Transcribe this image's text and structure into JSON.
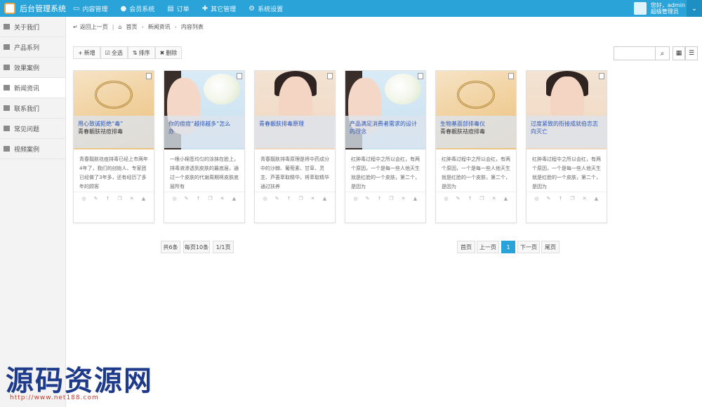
{
  "app": {
    "title": "后台管理系统"
  },
  "nav": [
    {
      "label": "内容管理",
      "icon": "monitor-icon"
    },
    {
      "label": "会员系统",
      "icon": "user-icon"
    },
    {
      "label": "订单",
      "icon": "order-icon"
    },
    {
      "label": "其它管理",
      "icon": "puzzle-icon"
    },
    {
      "label": "系统设置",
      "icon": "gear-icon"
    }
  ],
  "user": {
    "greeting": "您好，admin",
    "role": "超级管理员"
  },
  "sidebar": {
    "items": [
      {
        "label": "关于我们"
      },
      {
        "label": "产品系列"
      },
      {
        "label": "效果案例"
      },
      {
        "label": "新闻资讯"
      },
      {
        "label": "联系我们"
      },
      {
        "label": "常见问题"
      },
      {
        "label": "视频案例"
      }
    ]
  },
  "breadcrumb": {
    "back": "返回上一页",
    "home": "首页",
    "section": "新闻资讯",
    "current": "内容列表"
  },
  "toolbar": {
    "add": "新增",
    "all": "全选",
    "sort": "排序",
    "delete": "删除"
  },
  "search": {
    "placeholder": ""
  },
  "cards": [
    {
      "title": "用心致诚拒绝“毒”",
      "subtitle": "青春靓肤祛痘排毒",
      "text": "青春靓肤祛痘排毒已经上市两年4年了，我们的创始人、专家团已经做了3年多，还有经历了多年的顾客"
    },
    {
      "title": "你的痘痘“越排越多”怎么",
      "subtitle": "办",
      "text": "一根小棉签均匀的涂抹在脸上，排毒液渗透到皮肤的最底层，通过一个皮肤的代谢周期将皮肤底层所有"
    },
    {
      "title": "青春靓肤排毒原理",
      "subtitle": "",
      "text": "青春靓肤排毒原理是将中药成分中的沙棘、葡萄素、甘草、灵芝、芦荟萃取精华，将萃取精华通过扶养"
    },
    {
      "title": "产品满足消费者需求的设计的理念",
      "subtitle": "",
      "text": "红肿毒过程中之所以会红，有两个原因，一个是每一些人他天生就是红脸的一个皮肤，第二个，是因为"
    },
    {
      "title": "生物基面部排毒仪",
      "subtitle": "青春靓肤祛痘排毒",
      "text": "红肿毒过程中之所以会红，有两个原因，一个是每一些人他天生就是红脸的一个皮肤，第二个，是因为"
    },
    {
      "title": "过度紧致的衔接成就伯恋志",
      "subtitle": "向灭亡",
      "text": "红肿毒过程中之所以会红，有两个原因，一个是每一些人他天生就是红脸的一个皮肤，第二个，是因为"
    }
  ],
  "pagination_info": {
    "total": "共6条",
    "per_page": "每页10条",
    "pages": "1/1页"
  },
  "pagination": {
    "first": "首页",
    "prev": "上一页",
    "current": "1",
    "next": "下一页",
    "last": "尾页"
  },
  "watermark": {
    "text": "源码资源网",
    "url": "http://www.net188.com"
  },
  "colors": {
    "accent": "#2aa3d9",
    "sidebar_bg": "#f3f3f3",
    "link": "#2a56b8"
  }
}
